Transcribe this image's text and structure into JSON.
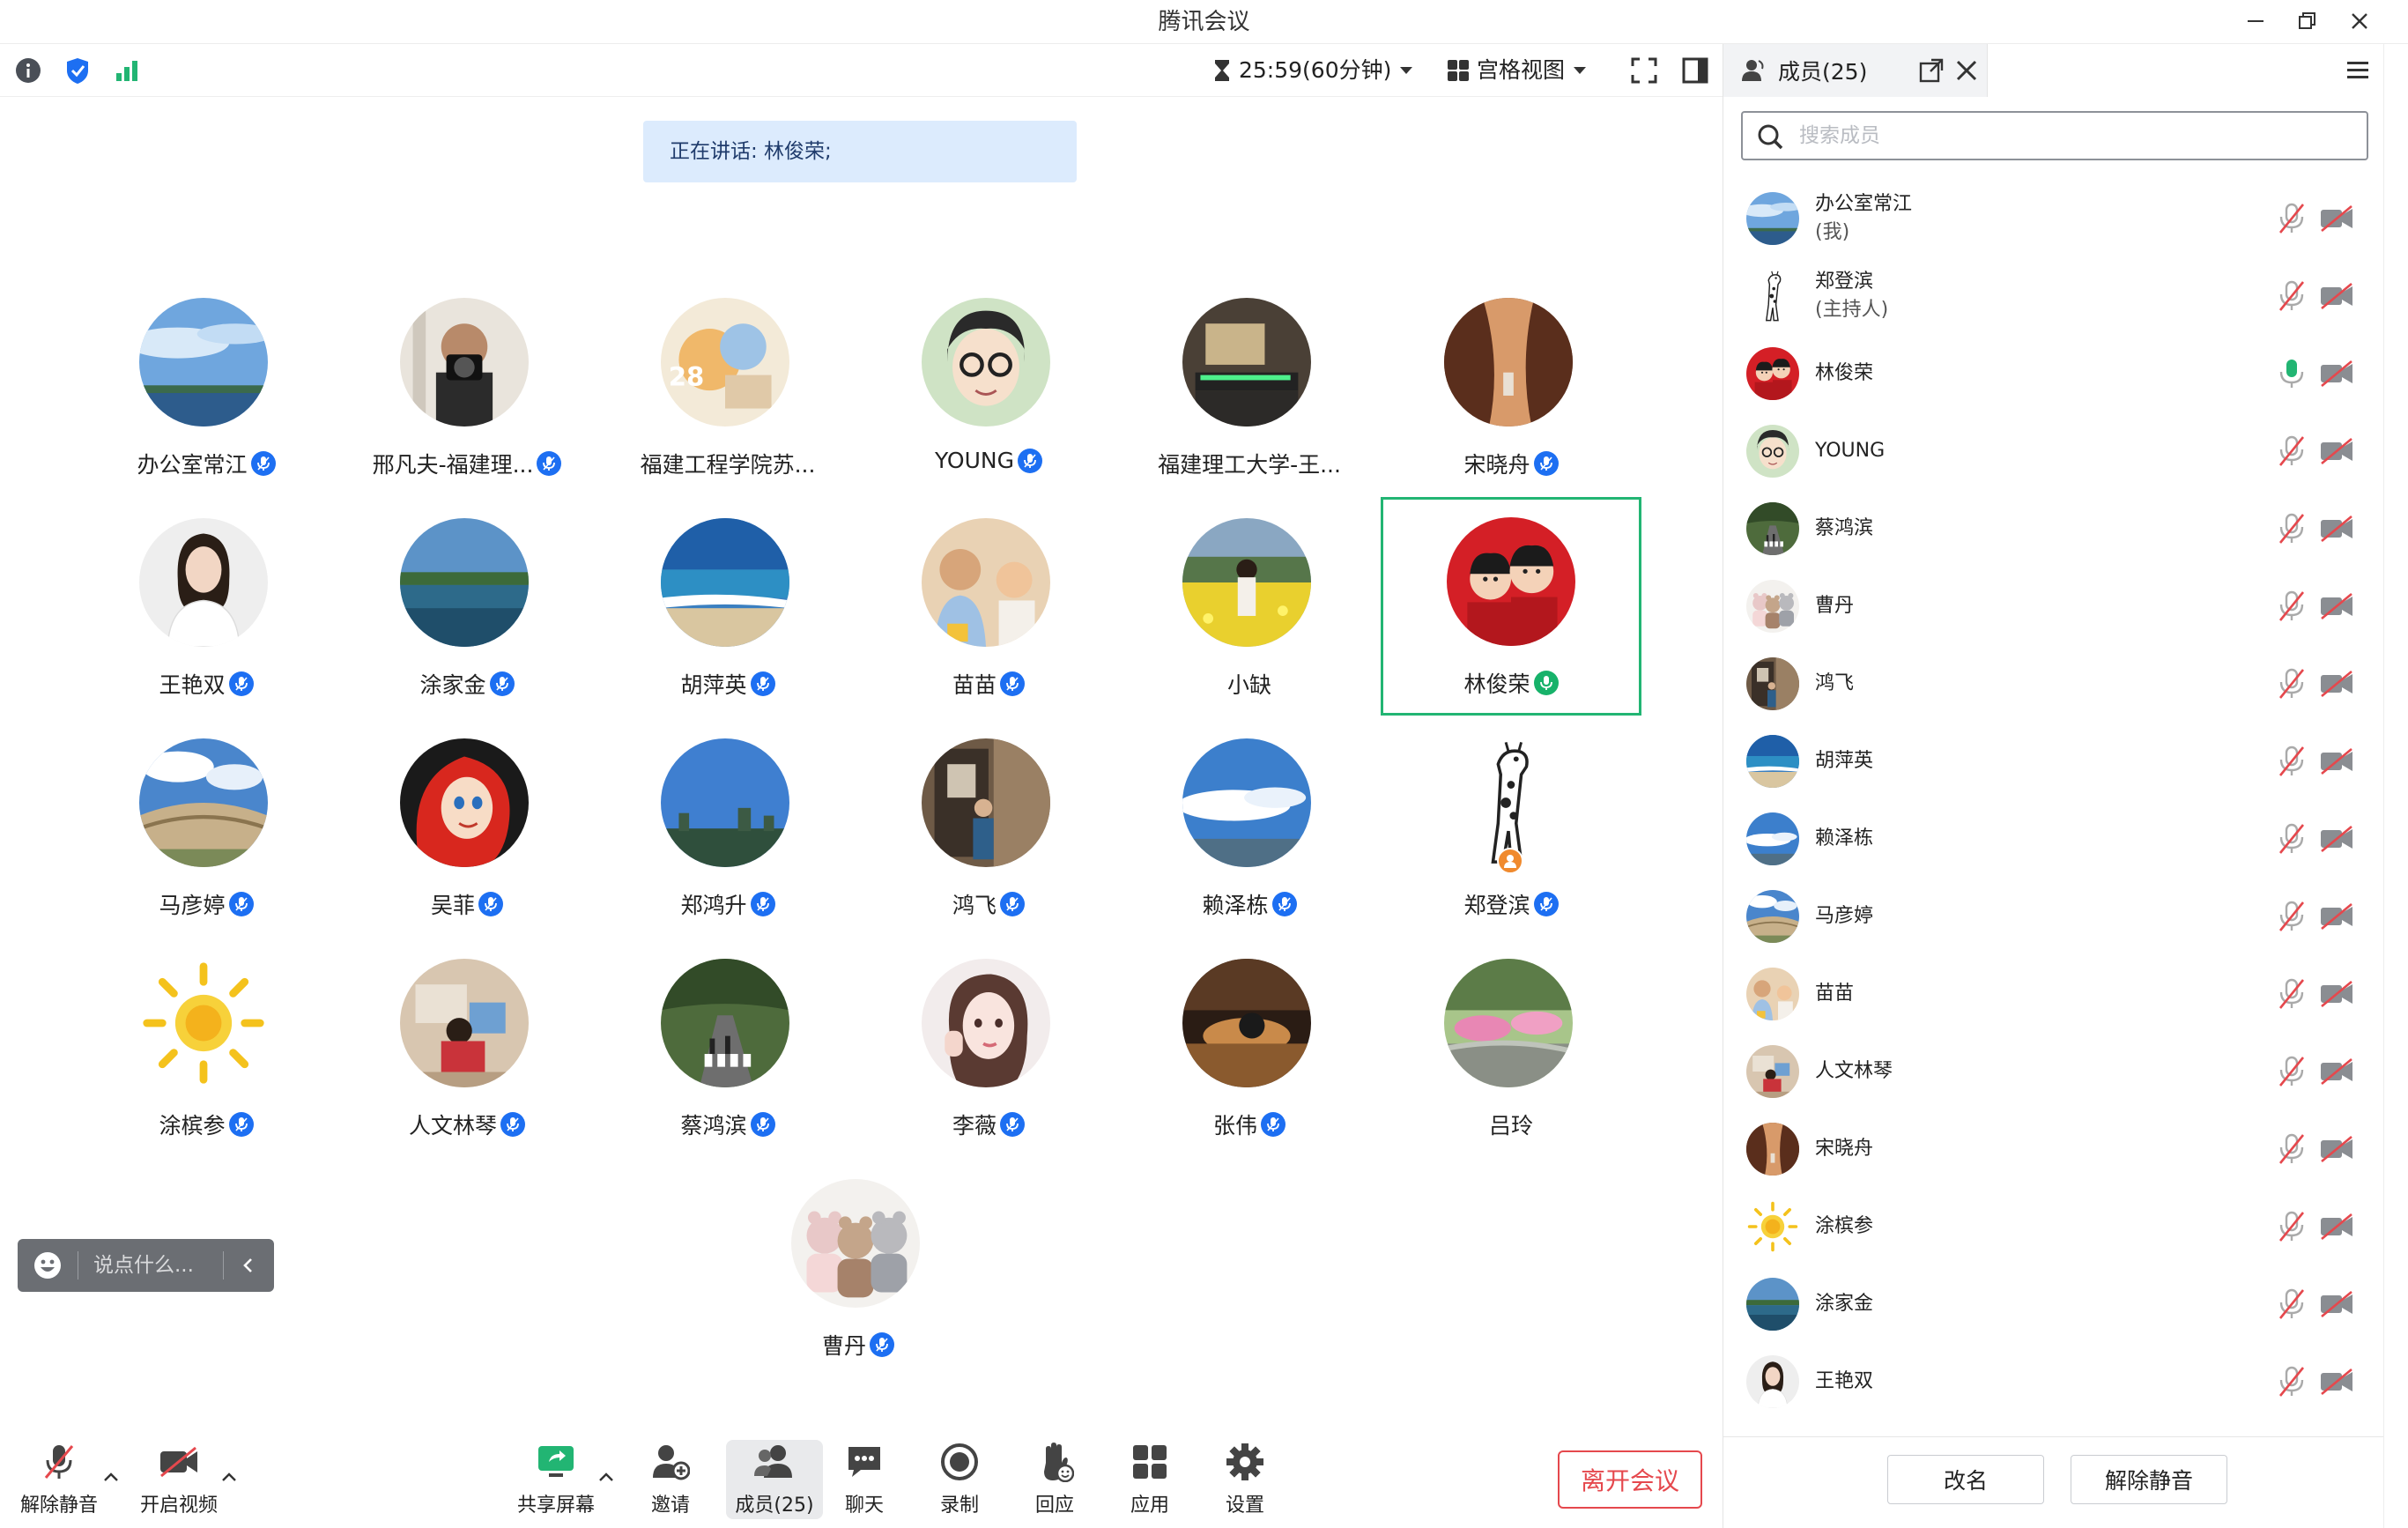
{
  "window": {
    "title": "腾讯会议"
  },
  "toolbar": {
    "timer": "25:59(60分钟)",
    "view_label": "宫格视图"
  },
  "speaking": {
    "text": "正在讲话: 林俊荣;"
  },
  "participants": [
    {
      "name": "办公室常江",
      "avatar": "sky"
    },
    {
      "name": "邢凡夫-福建理...",
      "avatar": "camera-man"
    },
    {
      "name": "福建工程学院苏...",
      "avatar": "cartoon-28",
      "no_mic": true
    },
    {
      "name": "YOUNG",
      "avatar": "glasses-cartoon"
    },
    {
      "name": "福建理工大学-王...",
      "avatar": "desk",
      "no_mic": true
    },
    {
      "name": "宋晓舟",
      "avatar": "canyon"
    },
    {
      "name": "王艳双",
      "avatar": "woman-white"
    },
    {
      "name": "涂家金",
      "avatar": "lake"
    },
    {
      "name": "胡萍英",
      "avatar": "beach"
    },
    {
      "name": "苗苗",
      "avatar": "kids"
    },
    {
      "name": "小缺",
      "avatar": "flowers-girl",
      "no_mic": true
    },
    {
      "name": "林俊荣",
      "avatar": "two-boys",
      "active": true,
      "speaking": true
    },
    {
      "name": "马彦婷",
      "avatar": "crescent"
    },
    {
      "name": "吴菲",
      "avatar": "mermaid"
    },
    {
      "name": "郑鸿升",
      "avatar": "city-sky"
    },
    {
      "name": "鸿飞",
      "avatar": "man-door"
    },
    {
      "name": "赖泽栋",
      "avatar": "clouds"
    },
    {
      "name": "郑登滨",
      "avatar": "giraffe",
      "host": true
    },
    {
      "name": "涂槟参",
      "avatar": "sun"
    },
    {
      "name": "人文林琴",
      "avatar": "child-room"
    },
    {
      "name": "蔡鸿滨",
      "avatar": "road"
    },
    {
      "name": "李薇",
      "avatar": "girl-drawn"
    },
    {
      "name": "张伟",
      "avatar": "sleep"
    },
    {
      "name": "吕玲",
      "avatar": "garden",
      "no_mic": true
    },
    {
      "name": "曹丹",
      "avatar": "plush"
    }
  ],
  "chat": {
    "placeholder": "说点什么..."
  },
  "bottom": {
    "unmute": "解除静音",
    "video": "开启视频",
    "share": "共享屏幕",
    "invite": "邀请",
    "members": "成员(25)",
    "chat": "聊天",
    "record": "录制",
    "react": "回应",
    "apps": "应用",
    "settings": "设置",
    "leave": "离开会议"
  },
  "panel": {
    "tab": "成员(25)",
    "search_placeholder": "搜索成员",
    "members": [
      {
        "name": "办公室常江",
        "sub": "(我)",
        "avatar": "sky"
      },
      {
        "name": "郑登滨",
        "sub": "(主持人)",
        "avatar": "giraffe"
      },
      {
        "name": "林俊荣",
        "avatar": "two-boys",
        "mic_on": true
      },
      {
        "name": "YOUNG",
        "avatar": "glasses-cartoon"
      },
      {
        "name": "蔡鸿滨",
        "avatar": "road"
      },
      {
        "name": "曹丹",
        "avatar": "plush"
      },
      {
        "name": "鸿飞",
        "avatar": "man-door"
      },
      {
        "name": "胡萍英",
        "avatar": "beach"
      },
      {
        "name": "赖泽栋",
        "avatar": "clouds"
      },
      {
        "name": "马彦婷",
        "avatar": "crescent"
      },
      {
        "name": "苗苗",
        "avatar": "kids"
      },
      {
        "name": "人文林琴",
        "avatar": "child-room"
      },
      {
        "name": "宋晓舟",
        "avatar": "canyon"
      },
      {
        "name": "涂槟参",
        "avatar": "sun"
      },
      {
        "name": "涂家金",
        "avatar": "lake"
      },
      {
        "name": "王艳双",
        "avatar": "woman-white"
      }
    ],
    "rename": "改名",
    "unmute_all": "解除静音"
  },
  "colors": {
    "accent": "#1d6ff2",
    "speaking": "#17b26a",
    "leave": "#e5484d",
    "active_border": "#22b573"
  }
}
